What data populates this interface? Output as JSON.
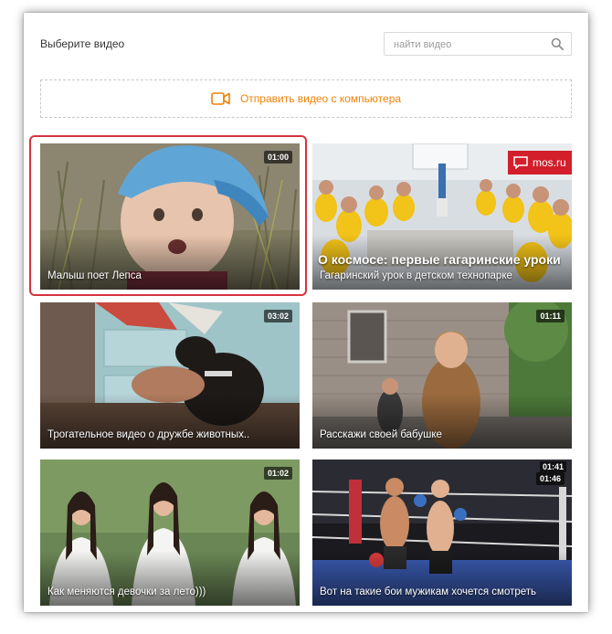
{
  "header": {
    "title": "Выберите видео",
    "search_placeholder": "найти видео",
    "search_icon": "search-icon"
  },
  "upload": {
    "label": "Отправить видео с компьютера",
    "icon": "video-camera-icon",
    "accent_color": "#ee8208"
  },
  "selection_color": "#d6333f",
  "videos": [
    {
      "title": "Малыш поет Лепса",
      "duration": "01:00",
      "selected": true
    },
    {
      "title": "Гагаринский урок в детском технопарке",
      "duration": "",
      "overlay_headline": "О космосе: первые гагаринские уроки",
      "badge": "mos.ru"
    },
    {
      "title": "Трогательное видео о дружбе животных..",
      "duration": "03:02"
    },
    {
      "title": "Расскажи своей бабушке",
      "duration": "01:11"
    },
    {
      "title": "Как меняются девочки за лето)))",
      "duration": "01:02"
    },
    {
      "title": "Вот на такие бои мужикам хочется смотреть",
      "duration": "01:46",
      "duration_secondary": "01:41"
    }
  ]
}
